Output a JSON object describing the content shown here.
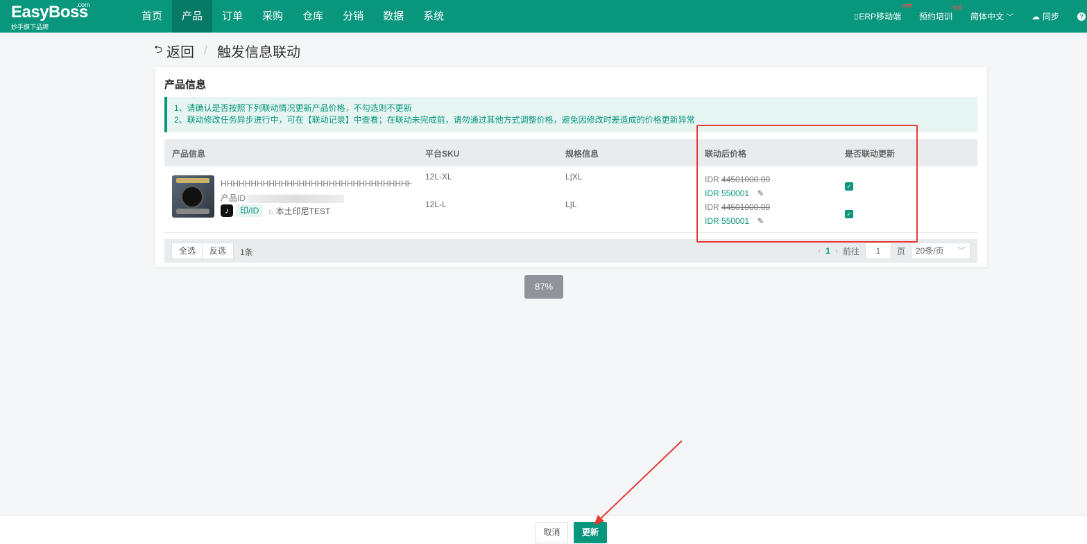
{
  "brand": {
    "name": "EasyBoss",
    "suffix": ".com",
    "slogan": "妙手旗下品牌"
  },
  "nav": [
    "首页",
    "产品",
    "订单",
    "采购",
    "仓库",
    "分销",
    "数据",
    "系统"
  ],
  "nav_active": "产品",
  "top_right": {
    "mobile": "ERP移动端",
    "mobile_tag": "HOT",
    "training": "预约培训",
    "training_tag": "免费",
    "language": "简体中文",
    "sync": "同步"
  },
  "breadcrumb": {
    "back": "返回",
    "title": "触发信息联动"
  },
  "card": {
    "title": "产品信息",
    "notices": [
      "1、请确认是否按照下列联动情况更新产品价格，不勾选则不更新",
      "2、联动修改任务异步进行中，可在【联动记录】中查看；在联动未完成前，请勿通过其他方式调整价格，避免因修改时差造成的价格更新异常"
    ],
    "columns": [
      "产品信息",
      "平台SKU",
      "规格信息",
      "联动后价格",
      "是否联动更新"
    ],
    "product": {
      "name": "HHHHHHHHHHHHHHHHHHHHHHHHHHHHHHHHHHHHHHHH",
      "id_label": "产品ID",
      "region": "印/ID",
      "shop": "本土印尼TEST"
    },
    "skus": [
      {
        "sku": "12L-XL",
        "spec": "L|XL",
        "currency": "IDR",
        "old_price": "44501000.00",
        "new_price": "IDR 550001",
        "checked": true
      },
      {
        "sku": "12L-L",
        "spec": "L|L",
        "currency": "IDR",
        "old_price": "44501000.00",
        "new_price": "IDR 550001",
        "checked": true
      }
    ],
    "footer": {
      "select_all": "全选",
      "invert": "反选",
      "count": "1条",
      "current_page": "1",
      "goto_label": "前往",
      "goto_value": "1",
      "page_unit": "页",
      "page_size": "20条/页"
    }
  },
  "progress": "87%",
  "actions": {
    "cancel": "取消",
    "update": "更新"
  }
}
